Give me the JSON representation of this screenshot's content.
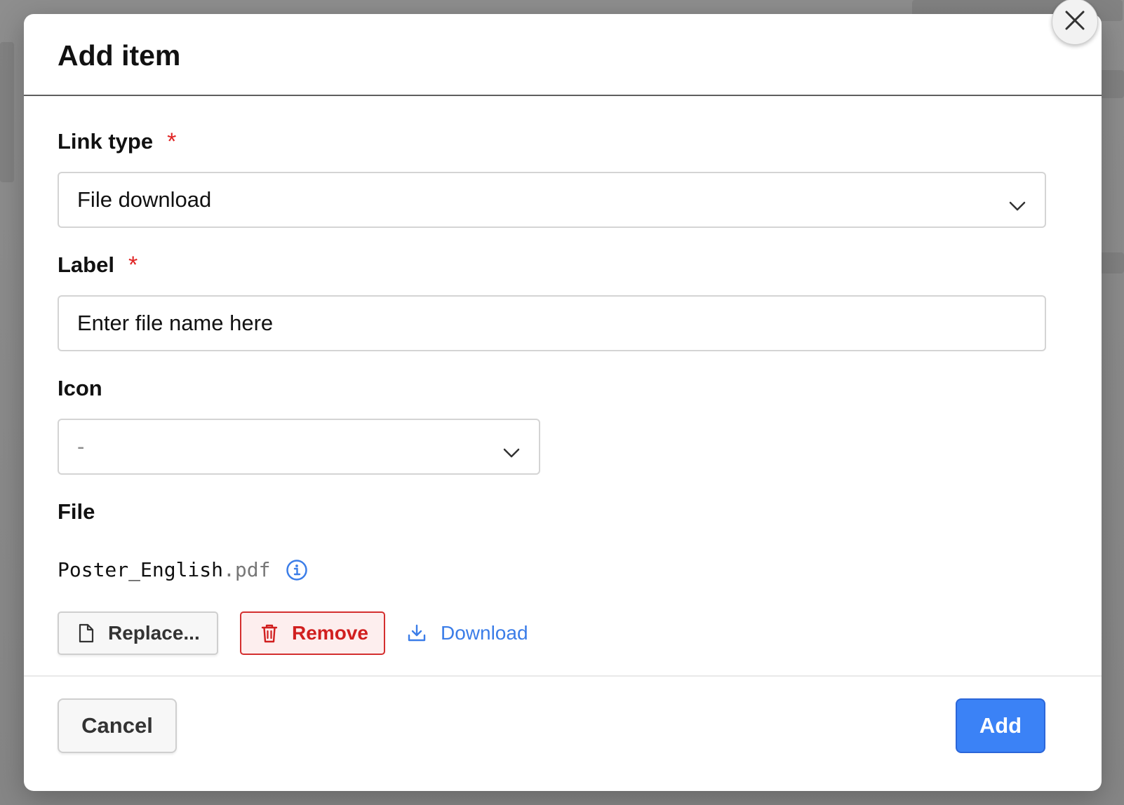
{
  "modal": {
    "title": "Add item"
  },
  "form": {
    "link_type": {
      "label": "Link type",
      "required_mark": "*",
      "value": "File download"
    },
    "label_field": {
      "label": "Label",
      "required_mark": "*",
      "placeholder": "Enter file name here"
    },
    "icon": {
      "label": "Icon",
      "value": "-"
    },
    "file": {
      "label": "File",
      "name": "Poster_English",
      "extension": ".pdf"
    }
  },
  "file_actions": {
    "replace_label": "Replace...",
    "remove_label": "Remove",
    "download_label": "Download"
  },
  "footer": {
    "cancel_label": "Cancel",
    "add_label": "Add"
  },
  "colors": {
    "required": "#e02424",
    "primary": "#3b82f6",
    "danger": "#d11f1f",
    "link": "#3b7de8"
  },
  "icons": {
    "close": "close-icon",
    "chevron": "chevron-down-icon",
    "info": "info-icon",
    "file": "file-icon",
    "trash": "trash-icon",
    "download": "download-icon"
  }
}
